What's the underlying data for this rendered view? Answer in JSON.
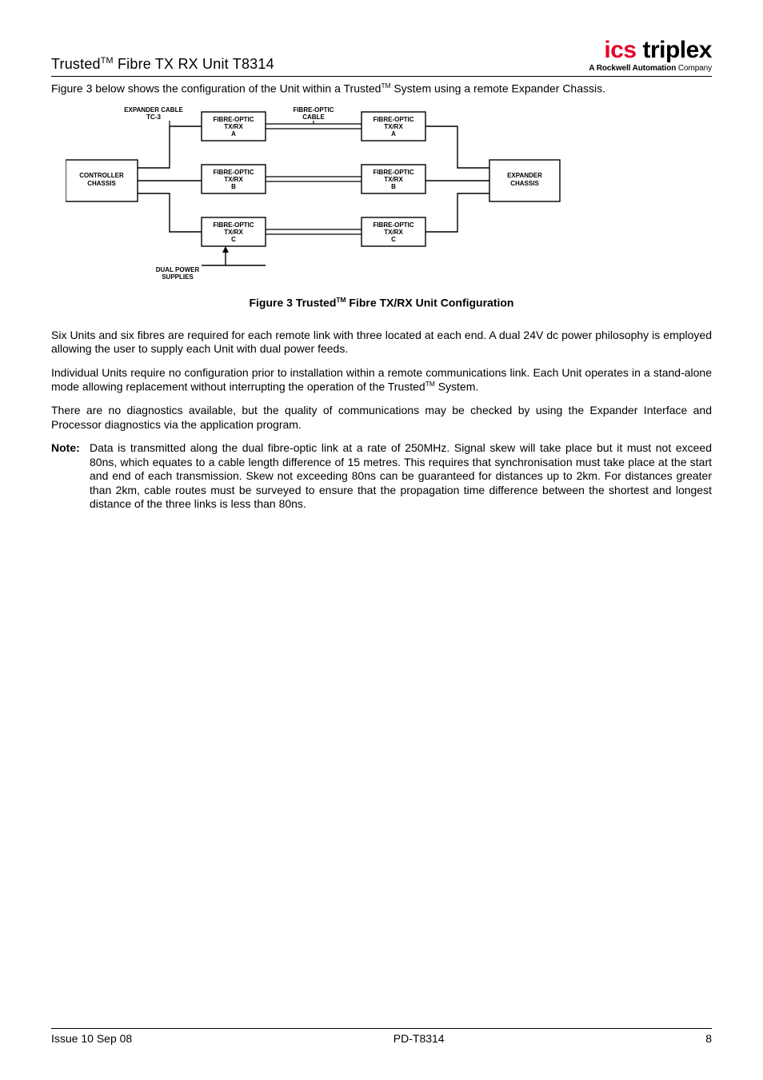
{
  "header": {
    "title_prefix": "Trusted",
    "title_tm": "TM",
    "title_suffix": " Fibre TX RX Unit T8314"
  },
  "logo": {
    "first": "ics",
    "rest": " triplex",
    "tag_strong": "A Rockwell Automation",
    "tag_light": " Company"
  },
  "intro": {
    "prefix": "Figure 3 below shows the configuration of the Unit within a Trusted",
    "tm": "TM",
    "suffix": " System using a remote Expander Chassis."
  },
  "diagram": {
    "expander_cable_l1": "EXPANDER CABLE",
    "expander_cable_l2": "TC-3",
    "fo_txrx": "FIBRE-OPTIC",
    "txrx": "TX/RX",
    "a": "A",
    "b": "B",
    "c": "C",
    "fo_cable": "FIBRE-OPTIC",
    "cable": "CABLE",
    "controller_l1": "CONTROLLER",
    "controller_l2": "CHASSIS",
    "expander_l1": "EXPANDER",
    "expander_l2": "CHASSIS",
    "dual_l1": "DUAL POWER",
    "dual_l2": "SUPPLIES"
  },
  "caption": {
    "prefix": "Figure 3 Trusted",
    "tm": "TM",
    "suffix": " Fibre TX/RX Unit Configuration"
  },
  "p1": "Six Units and six fibres are required for each remote link with three located at each end.  A dual 24V dc power philosophy is employed allowing the user to supply each Unit with dual power feeds.",
  "p2": {
    "prefix": "Individual Units require no configuration prior to installation within a remote communications link.  Each Unit operates in a stand-alone mode allowing replacement without interrupting the operation of the Trusted",
    "tm": "TM",
    "suffix": " System."
  },
  "p3": "There are no diagnostics available, but the quality of communications may be checked by using the Expander Interface and Processor diagnostics via the application program.",
  "note": {
    "label": "Note:",
    "body": "Data is transmitted along the dual fibre-optic link at a rate of 250MHz.  Signal skew will take place but it must not exceed 80ns, which equates to a cable length difference of 15 metres.  This requires that synchronisation must take place at the start and end of each transmission.  Skew not exceeding 80ns can be guaranteed for distances up to 2km.  For distances greater than 2km, cable routes must be surveyed to ensure that the propagation time difference between the shortest and longest distance of the three links is less than 80ns."
  },
  "footer": {
    "left": "Issue 10 Sep 08",
    "center": "PD-T8314",
    "right": "8"
  }
}
